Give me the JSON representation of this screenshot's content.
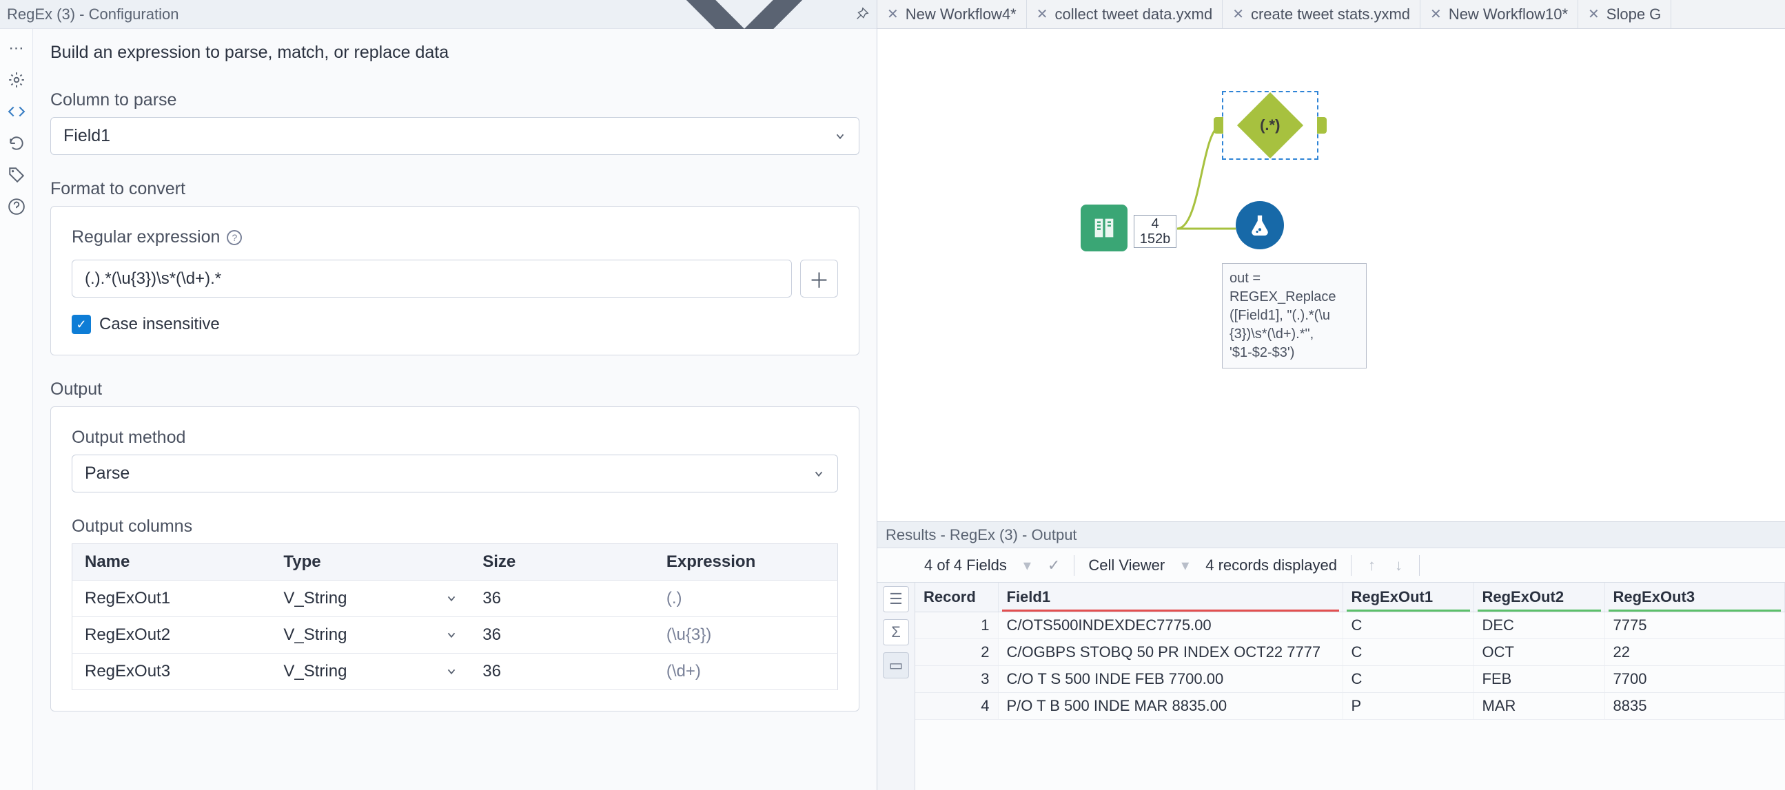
{
  "config": {
    "title": "RegEx (3) - Configuration",
    "subtitle": "Build an expression to parse, match, or replace data",
    "column_label": "Column to parse",
    "column_value": "Field1",
    "format_label": "Format to convert",
    "regex_label": "Regular expression",
    "regex_value": "(.).*(\\u{3})\\s*(\\d+).*",
    "case_insensitive_label": "Case insensitive",
    "output_label": "Output",
    "output_method_label": "Output method",
    "output_method_value": "Parse",
    "output_columns_label": "Output columns",
    "columns_header": {
      "name": "Name",
      "type": "Type",
      "size": "Size",
      "expr": "Expression"
    },
    "columns": [
      {
        "name": "RegExOut1",
        "type": "V_String",
        "size": "36",
        "expr": "(.)"
      },
      {
        "name": "RegExOut2",
        "type": "V_String",
        "size": "36",
        "expr": "(\\u{3})"
      },
      {
        "name": "RegExOut3",
        "type": "V_String",
        "size": "36",
        "expr": "(\\d+)"
      }
    ]
  },
  "tabs": [
    {
      "label": "New Workflow4*"
    },
    {
      "label": "collect tweet data.yxmd"
    },
    {
      "label": "create tweet stats.yxmd"
    },
    {
      "label": "New Workflow10*"
    },
    {
      "label": "Slope G"
    }
  ],
  "canvas": {
    "badge_top": "4",
    "badge_bottom": "152b",
    "regex_label": "(.*)",
    "annot_l1": "out =",
    "annot_l2": "REGEX_Replace",
    "annot_l3": "([Field1], \"(.).*(\\u",
    "annot_l4": "{3})\\s*(\\d+).*\",",
    "annot_l5": "'$1-$2-$3')"
  },
  "results": {
    "title": "Results - RegEx (3) - Output",
    "toolbar_fields": "4 of 4 Fields",
    "toolbar_cellviewer": "Cell Viewer",
    "toolbar_records": "4 records displayed",
    "headers": {
      "record": "Record",
      "f1": "Field1",
      "r1": "RegExOut1",
      "r2": "RegExOut2",
      "r3": "RegExOut3"
    },
    "rows": [
      {
        "n": "1",
        "f1": "C/OTS500INDEXDEC7775.00",
        "r1": "C",
        "r2": "DEC",
        "r3": "7775"
      },
      {
        "n": "2",
        "f1": "C/OGBPS STOBQ 50 PR INDEX OCT22 7777",
        "r1": "C",
        "r2": "OCT",
        "r3": "22"
      },
      {
        "n": "3",
        "f1": "C/O T S 500 INDE FEB 7700.00",
        "r1": "C",
        "r2": "FEB",
        "r3": "7700"
      },
      {
        "n": "4",
        "f1": "P/O T B 500 INDE MAR 8835.00",
        "r1": "P",
        "r2": "MAR",
        "r3": "8835"
      }
    ]
  }
}
